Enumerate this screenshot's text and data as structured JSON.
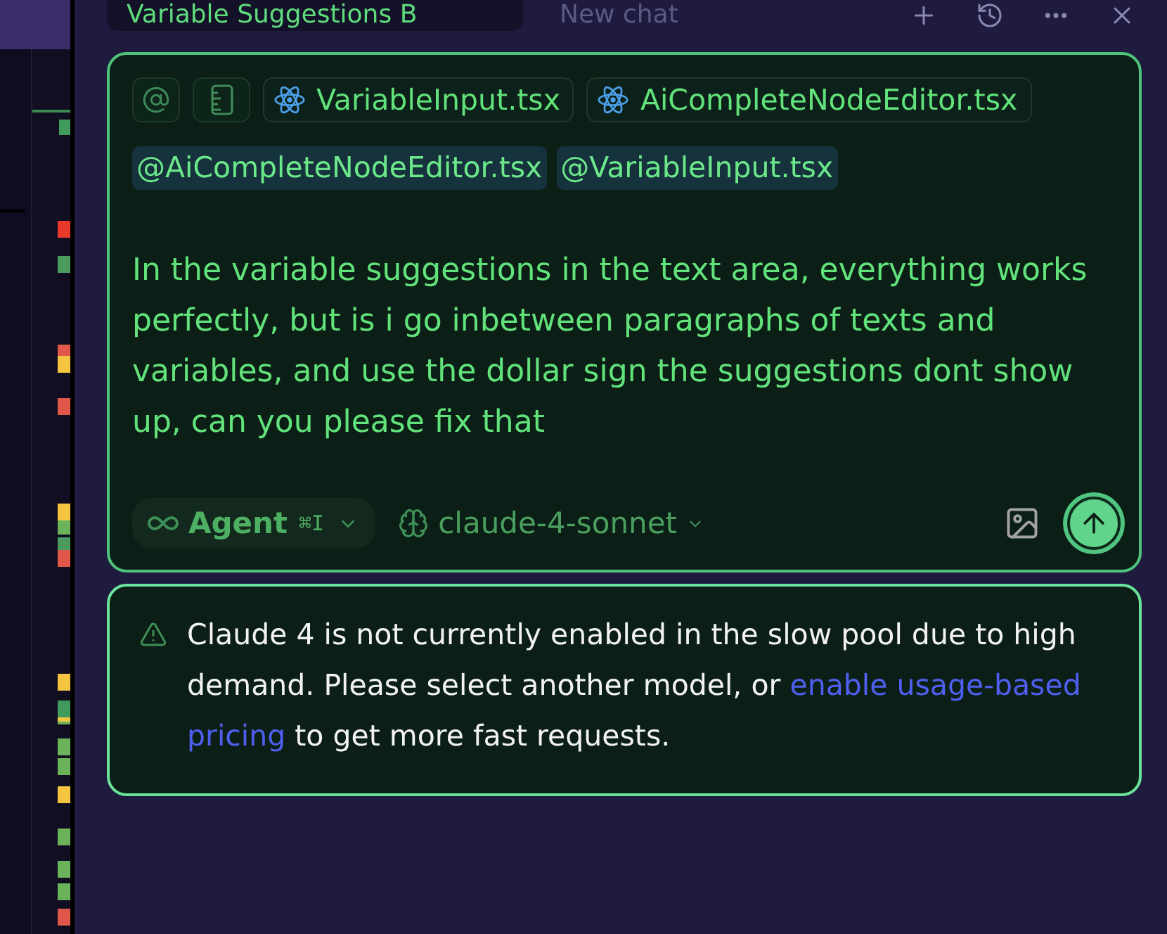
{
  "tabs": [
    {
      "label": "Variable Suggestions B",
      "selected": true
    },
    {
      "label": "New chat",
      "selected": false
    }
  ],
  "composer": {
    "context_chips": [
      {
        "label": "VariableInput.tsx"
      },
      {
        "label": "AiCompleteNodeEditor.tsx"
      }
    ],
    "mentions": [
      "@AiCompleteNodeEditor.tsx",
      "@VariableInput.tsx"
    ],
    "message": "In the variable suggestions in the text area, everything works perfectly, but is i go inbetween paragraphs of texts and variables, and use the dollar sign the suggestions dont show up, can you please fix that",
    "mode": {
      "label": "Agent",
      "shortcut": "⌘I"
    },
    "model": "claude-4-sonnet"
  },
  "notice": {
    "segments": [
      {
        "kind": "text",
        "text": "Claude 4 is not currently enabled in the slow pool due to high demand. Please select another model, or"
      },
      {
        "kind": "link",
        "text": "enable usage-based"
      },
      {
        "kind": "link",
        "text": "pricing"
      },
      {
        "kind": "text",
        "text": "to get more fast requests."
      }
    ]
  }
}
